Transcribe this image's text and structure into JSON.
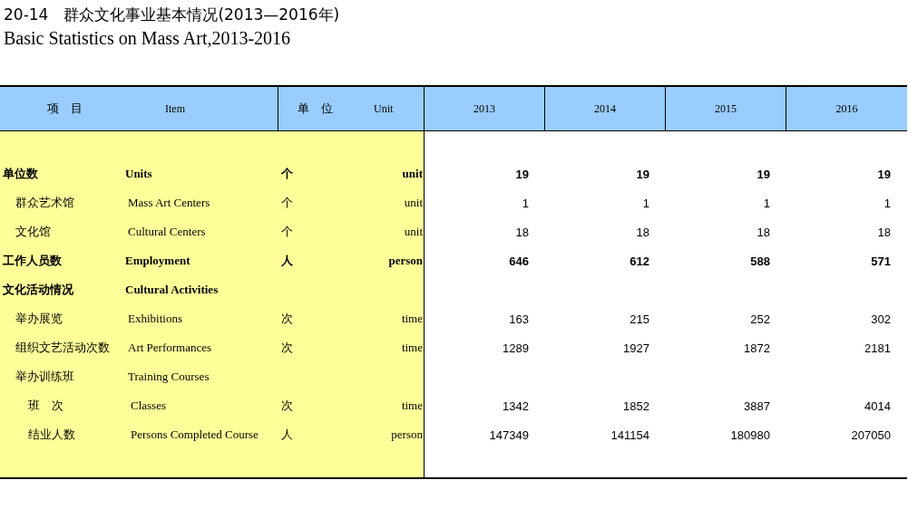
{
  "title": "20-14　群众文化事业基本情况(2013—2016年)",
  "subtitle": "Basic Statistics on Mass Art,2013-2016",
  "table": {
    "header": {
      "item_cn": "项　目",
      "item_en": "Item",
      "unit_cn": "单　位",
      "unit_en": "Unit",
      "years": [
        "2013",
        "2014",
        "2015",
        "2016"
      ]
    },
    "rows": [
      {
        "name_cn": "单位数",
        "name_en": "Units",
        "unit_cn": "个",
        "unit_en": "unit",
        "values": [
          "19",
          "19",
          "19",
          "19"
        ],
        "children": [
          {
            "name_cn": "群众艺术馆",
            "name_en": "Mass Art Centers",
            "unit_cn": "个",
            "unit_en": "unit",
            "values": [
              "1",
              "1",
              "1",
              "1"
            ]
          },
          {
            "name_cn": "文化馆",
            "name_en": "Cultural Centers",
            "unit_cn": "个",
            "unit_en": "unit",
            "values": [
              "18",
              "18",
              "18",
              "18"
            ]
          }
        ]
      },
      {
        "name_cn": "工作人员数",
        "name_en": "Employment",
        "unit_cn": "人",
        "unit_en": "person",
        "values": [
          "646",
          "612",
          "588",
          "571"
        ]
      },
      {
        "name_cn": "文化活动情况",
        "name_en": "Cultural Activities",
        "children": [
          {
            "name_cn": "举办展览",
            "name_en": "Exhibitions",
            "unit_cn": "次",
            "unit_en": "time",
            "values": [
              "163",
              "215",
              "252",
              "302"
            ]
          },
          {
            "name_cn": "组织文艺活动次数",
            "name_en": "Art Performances",
            "unit_cn": "次",
            "unit_en": "time",
            "values": [
              "1289",
              "1927",
              "1872",
              "2181"
            ]
          },
          {
            "name_cn": "举办训练班",
            "name_en": "Training Courses",
            "children": [
              {
                "name_cn": "班　次",
                "name_en": "Classes",
                "unit_cn": "次",
                "unit_en": "time",
                "values": [
                  "1342",
                  "1852",
                  "3887",
                  "4014"
                ]
              },
              {
                "name_cn": "结业人数",
                "name_en": "Persons Completed Course",
                "unit_cn": "人",
                "unit_en": "person",
                "values": [
                  "147349",
                  "141154",
                  "180980",
                  "207050"
                ]
              }
            ]
          }
        ]
      }
    ]
  }
}
